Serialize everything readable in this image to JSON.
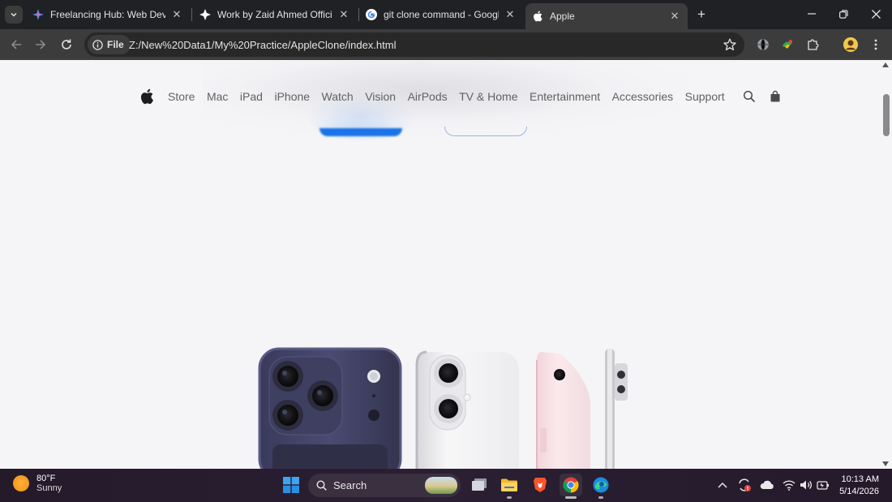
{
  "browser": {
    "tabs": [
      {
        "title": "Freelancing Hub: Web Dev & Yo",
        "active": false
      },
      {
        "title": "Work by Zaid Ahmed Official",
        "active": false
      },
      {
        "title": "git clone command - Google Se",
        "active": false
      },
      {
        "title": "Apple",
        "active": true
      }
    ],
    "security_chip": "File",
    "url": "Z:/New%20Data1/My%20Practice/AppleClone/index.html"
  },
  "page": {
    "nav_items": [
      "Store",
      "Mac",
      "iPad",
      "iPhone",
      "Watch",
      "Vision",
      "AirPods",
      "TV & Home",
      "Entertainment",
      "Accessories",
      "Support"
    ]
  },
  "taskbar": {
    "weather_temp": "80°F",
    "weather_desc": "Sunny",
    "search_label": "Search",
    "time": "10:13 AM",
    "date": "5/14/2026"
  },
  "colors": {
    "tab_strip": "#202124",
    "toolbar": "#3c3c3c",
    "page_bg": "#f5f5f7",
    "nav_text": "#616161",
    "accent_blue": "#1a73e8"
  }
}
